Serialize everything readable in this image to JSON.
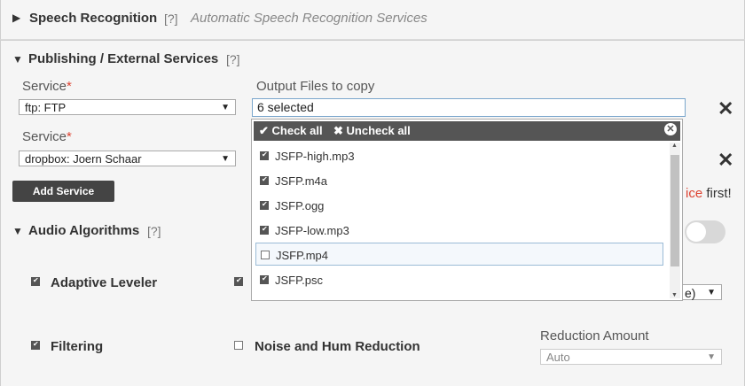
{
  "speech": {
    "title": "Speech Recognition",
    "help": "[?]",
    "subtitle": "Automatic Speech Recognition Services",
    "collapsed_icon": "triangle-right-icon"
  },
  "publishing": {
    "title": "Publishing / External Services",
    "help": "[?]",
    "service_label": "Service",
    "required_mark": "*",
    "output_label": "Output Files to copy",
    "services": [
      {
        "value": "ftp: FTP",
        "files_value": "6 selected"
      },
      {
        "value": "dropbox: Joern Schaar"
      }
    ],
    "add_button": "Add Service",
    "partial_hint_red": "ice",
    "partial_hint_black": " first!"
  },
  "dropdown": {
    "check_all": "Check all",
    "uncheck_all": "Uncheck all",
    "items": [
      {
        "label": "JSFP-high.mp3",
        "checked": true
      },
      {
        "label": "JSFP.m4a",
        "checked": true
      },
      {
        "label": "JSFP.ogg",
        "checked": true
      },
      {
        "label": "JSFP-low.mp3",
        "checked": true
      },
      {
        "label": "JSFP.mp4",
        "checked": false
      },
      {
        "label": "JSFP.psc",
        "checked": true
      }
    ]
  },
  "audio": {
    "title": "Audio Algorithms",
    "help": "[?]",
    "adaptive_leveler": "Adaptive Leveler",
    "filtering": "Filtering",
    "noise_reduction": "Noise and Hum Reduction",
    "reduction_amount_label": "Reduction Amount",
    "reduction_amount_value": "Auto",
    "partial_select_text": "e)"
  },
  "colors": {
    "required": "#dd4433",
    "dark": "#444444"
  }
}
